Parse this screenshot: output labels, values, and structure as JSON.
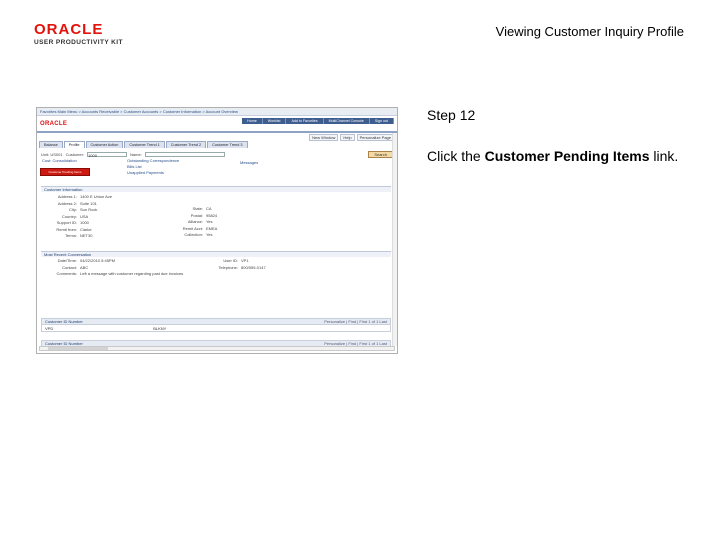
{
  "header": {
    "logo_word": "ORACLE",
    "logo_sub": "USER PRODUCTIVITY KIT",
    "title": "Viewing Customer Inquiry Profile"
  },
  "step": {
    "label": "Step 12"
  },
  "instruction": {
    "prefix": "Click the ",
    "target": "Customer Pending Items",
    "suffix": " link."
  },
  "screenshot": {
    "breadcrumb": "Favorites  Main Menu  > Accounts Receivable > Customer Accounts > Customer Information > Account Overview",
    "app_logo": "ORACLE",
    "top_nav": [
      "Home",
      "Worklist",
      "Add to Favorites",
      "MultiChannel Console",
      "Sign out"
    ],
    "add_fav": [
      "New Window",
      "Help",
      "Personalize Page"
    ],
    "tabs": [
      "Balance",
      "Profile",
      "Customer Action",
      "Customer Trend 1",
      "Customer Trend 2",
      "Customer Trend 3"
    ],
    "search_row": {
      "unit_label": "Unit: US001",
      "customer_label": "Customer:",
      "customer_value": "1000",
      "name_label": "Name:",
      "go_label": "Search"
    },
    "links_left": [
      "Unit: US001",
      "Cust: Consolidation"
    ],
    "links_mid": [
      "Outstanding Correspondence",
      "Bills List",
      "Unapplied Payments"
    ],
    "messages_link": "Messages",
    "red_button": "Customer Pending Items",
    "section_info": "Customer Information",
    "kv": [
      {
        "k": "Address 1:",
        "v": "1400 E Union Ave"
      },
      {
        "k": "Address 2:",
        "v": "Suite 101"
      },
      {
        "k": "City:",
        "v": "Sun Rock"
      },
      {
        "k": "Country:",
        "v": "USA"
      },
      {
        "k": "Support ID:",
        "v": "1000"
      },
      {
        "k": "Remit from:",
        "v": "Clarke"
      },
      {
        "k": "Terms:",
        "v": "NET30"
      }
    ],
    "kv2": [
      {
        "k": "State:",
        "v": "CA"
      },
      {
        "k": "Postal:",
        "v": "95824"
      },
      {
        "k": "Alliance:",
        "v": "Yes"
      },
      {
        "k": "Remit Acct:",
        "v": "EMEA"
      },
      {
        "k": "Collection:",
        "v": "Yes"
      }
    ],
    "conversation_header": "Most Recent Conversation",
    "conv_fields": [
      {
        "k": "Date/Time:",
        "v": "04/22/2010 5:45PM"
      },
      {
        "k": "User ID:",
        "v": "VP1"
      },
      {
        "k": "Contact:",
        "v": "ABC"
      },
      {
        "k": "Telephone:",
        "v": "800/555-0147"
      },
      {
        "k": "Comments:",
        "v": "Left a message with customer regarding past due invoices"
      }
    ],
    "grid1": {
      "title": "Customer ID Number",
      "nav": "Personalize | Find | First 1 of 1 Last",
      "cells": [
        "VPD",
        "BLKNY"
      ]
    },
    "grid2": {
      "title": "Customer ID Number",
      "nav": "Personalize | Find | First 1 of 1 Last"
    }
  }
}
